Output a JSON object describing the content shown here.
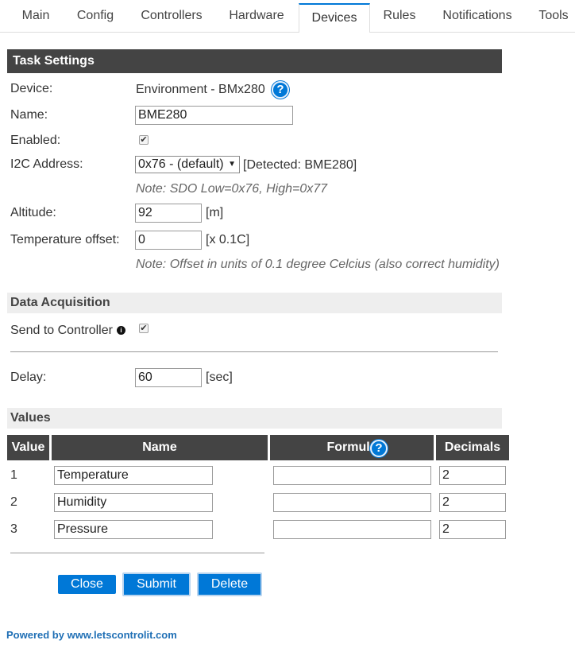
{
  "tabs": [
    {
      "label": "Main"
    },
    {
      "label": "Config"
    },
    {
      "label": "Controllers"
    },
    {
      "label": "Hardware"
    },
    {
      "label": "Devices",
      "active": true
    },
    {
      "label": "Rules"
    },
    {
      "label": "Notifications"
    },
    {
      "label": "Tools"
    }
  ],
  "task_settings": {
    "title": "Task Settings",
    "device_label": "Device:",
    "device_value": "Environment - BMx280",
    "name_label": "Name:",
    "name_value": "BME280",
    "enabled_label": "Enabled:",
    "enabled": true,
    "i2c_label": "I2C Address:",
    "i2c_selected": "0x76 - (default)",
    "i2c_detected": "[Detected: BME280]",
    "i2c_note": "Note: SDO Low=0x76, High=0x77",
    "altitude_label": "Altitude:",
    "altitude_value": "92",
    "altitude_unit": "[m]",
    "temp_offset_label": "Temperature offset:",
    "temp_offset_value": "0",
    "temp_offset_unit": "[x 0.1C]",
    "temp_offset_note": "Note: Offset in units of 0.1 degree Celcius (also correct humidity)"
  },
  "data_acquisition": {
    "title": "Data Acquisition",
    "send_label": "Send to Controller",
    "send_enabled": true,
    "delay_label": "Delay:",
    "delay_value": "60",
    "delay_unit": "[sec]"
  },
  "values": {
    "title": "Values",
    "headers": {
      "value": "Value",
      "name": "Name",
      "formula": "Formula",
      "decimals": "Decimals"
    },
    "rows": [
      {
        "index": "1",
        "name": "Temperature",
        "formula": "",
        "decimals": "2"
      },
      {
        "index": "2",
        "name": "Humidity",
        "formula": "",
        "decimals": "2"
      },
      {
        "index": "3",
        "name": "Pressure",
        "formula": "",
        "decimals": "2"
      }
    ]
  },
  "buttons": {
    "close": "Close",
    "submit": "Submit",
    "delete": "Delete"
  },
  "icons": {
    "help": "help-icon",
    "info": "info-icon",
    "checkbox": "checkmark-icon"
  },
  "colors": {
    "accent": "#0078d7",
    "header_dark": "#444444",
    "header_light": "#eeeeee",
    "link": "#1f6fb5"
  },
  "footer": {
    "text": "Powered by www.letscontrolit.com"
  }
}
